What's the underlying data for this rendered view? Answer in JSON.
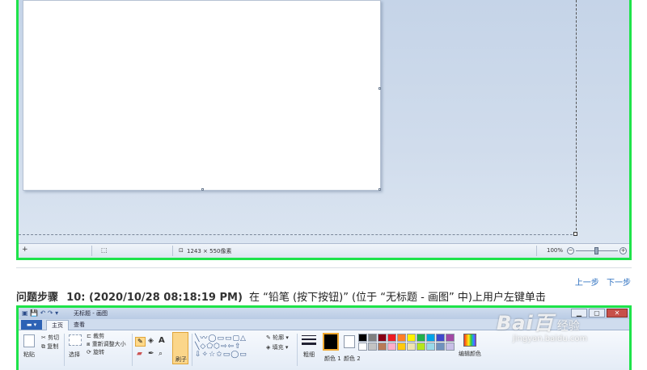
{
  "screenshot_top": {
    "status_bar": {
      "add_icon": "+",
      "selection_icon": "selection-icon",
      "canvas_size": "1243 × 550像素",
      "zoom": "100%",
      "zoom_out": "−",
      "zoom_in": "+"
    }
  },
  "step_nav": {
    "prev": "上一步",
    "next": "下一步"
  },
  "step": {
    "label": "问题步骤",
    "number_time": "10: (2020/10/28 08:18:19 PM)",
    "description": "在 “铅笔 (按下按钮)” (位于 “无标题 - 画图” 中)上用户左键单击"
  },
  "screenshot_bottom": {
    "window_title": "无标题 - 画图",
    "file_tab": "▬ ▾",
    "tabs": [
      "主页",
      "查看"
    ],
    "window_controls": [
      "▁",
      "▢",
      "✕"
    ],
    "ribbon": {
      "paste": "粘贴",
      "cut": "剪切",
      "copy": "复制",
      "select": "选择",
      "crop": "裁剪",
      "resize": "重新调整大小",
      "rotate": "旋转",
      "brush": "刷子",
      "outline": "轮廓",
      "fill": "填充",
      "size": "粗细",
      "color1": "颜色 1",
      "color2": "颜色 2",
      "edit_colors": "编辑颜色"
    },
    "shapes_text": "╲〰◯▭▭▢△\n╲◇⬠⬡⇨⇦⇧\n⇩✧☆✩▭◯▭",
    "palette": [
      "#000000",
      "#7f7f7f",
      "#880015",
      "#ed1c24",
      "#ff7f27",
      "#fff200",
      "#22b14c",
      "#00a2e8",
      "#3f48cc",
      "#a349a4",
      "#ffffff",
      "#c3c3c3",
      "#b97a57",
      "#ffaec9",
      "#ffc90e",
      "#efe4b0",
      "#b5e61d",
      "#99d9ea",
      "#7092be",
      "#c8bfe7"
    ]
  },
  "watermark": {
    "logo": "Bai百",
    "sub": "经验",
    "url": "jingyan.baidu.com"
  },
  "colors": {
    "highlight_border": "#1ee34a",
    "link": "#2a6ebf"
  }
}
